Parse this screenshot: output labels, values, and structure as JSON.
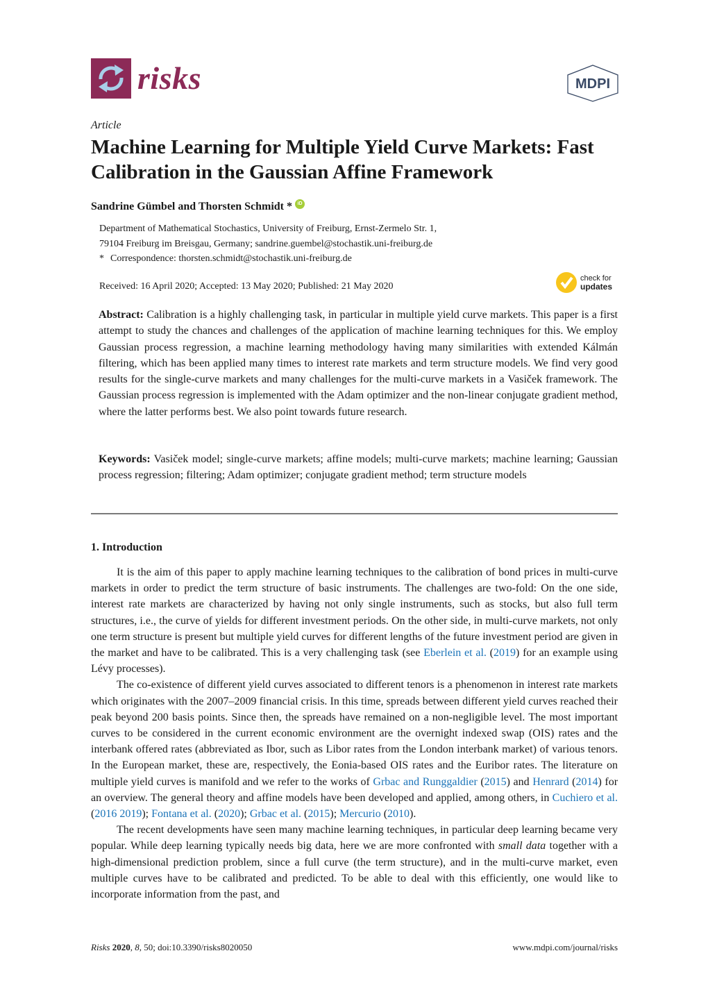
{
  "header": {
    "journal_name": "risks",
    "publisher_logo_text": "MDPI",
    "brand_color": "#8c2a57",
    "icon": "journal-logo-arrows-icon"
  },
  "article": {
    "type": "Article",
    "title": "Machine Learning for Multiple Yield Curve Markets: Fast Calibration in the Gaussian Affine Framework",
    "authors": "Sandrine Gümbel and Thorsten Schmidt *",
    "orcid_label": "iD",
    "affiliation_line1": "Department of Mathematical Stochastics, University of Freiburg, Ernst-Zermelo Str. 1,",
    "affiliation_line2": "79104 Freiburg im Breisgau, Germany; sandrine.guembel@stochastik.uni-freiburg.de",
    "correspondence_marker": "*",
    "correspondence": "Correspondence: thorsten.schmidt@stochastik.uni-freiburg.de",
    "dates": "Received: 16 April 2020; Accepted: 13 May 2020; Published: 21 May 2020",
    "check_updates": {
      "line1": "check for",
      "line2": "updates"
    }
  },
  "abstract": {
    "label": "Abstract:",
    "text": " Calibration is a highly challenging task, in particular in multiple yield curve markets. This paper is a first attempt to study the chances and challenges of the application of machine learning techniques for this. We employ Gaussian process regression, a machine learning methodology having many similarities with extended Kálmán filtering, which has been applied many times to interest rate markets and term structure models. We find very good results for the single-curve markets and many challenges for the multi-curve markets in a Vasiček framework. The Gaussian process regression is implemented with the Adam optimizer and the non-linear conjugate gradient method, where the latter performs best. We also point towards future research."
  },
  "keywords": {
    "label": "Keywords:",
    "text": " Vasiček model; single-curve markets; affine models; multi-curve markets; machine learning; Gaussian process regression; filtering; Adam optimizer; conjugate gradient method; term structure models"
  },
  "section": {
    "heading": "1. Introduction",
    "p1": {
      "a": "It is the aim of this paper to apply machine learning techniques to the calibration of bond prices in multi-curve markets in order to predict the term structure of basic instruments. The challenges are two-fold: On the one side, interest rate markets are characterized by having not only single instruments, such as stocks, but also full term structures, i.e., the curve of yields for different investment periods. On the other side, in multi-curve markets, not only one term structure is present but multiple yield curves for different lengths of the future investment period are given in the market and have to be calibrated. This is a very challenging task (see ",
      "cite1": "Eberlein et al.",
      "b": " (",
      "year1": "2019",
      "c": ") for an example using Lévy processes)."
    },
    "p2": {
      "a": "The co-existence of different yield curves associated to different tenors is a phenomenon in interest rate markets which originates with the 2007–2009 financial crisis. In this time, spreads between different yield curves reached their peak beyond 200 basis points. Since then, the spreads have remained on a non-negligible level. The most important curves to be considered in the current economic environment are the overnight indexed swap (OIS) rates and the interbank offered rates (abbreviated as Ibor, such as Libor rates from the London interbank market) of various tenors. In the European market, these are, respectively, the Eonia-based OIS rates and the Euribor rates. The literature on multiple yield curves is manifold and we refer to the works of ",
      "cite1": "Grbac and Runggaldier",
      "y1": "2015",
      "mid1": " and ",
      "cite2": "Henrard",
      "y2": "2014",
      "mid2": " for an overview. The general theory and affine models have been developed and applied, among others, in ",
      "cite3": "Cuchiero et al.",
      "y3": "2016 2019",
      "cite4": "Fontana et al.",
      "y4": "2020",
      "cite5": "Grbac et al.",
      "y5": "2015",
      "cite6": "Mercurio",
      "y6": "2010"
    },
    "p3": {
      "a": "The recent developments have seen many machine learning techniques, in particular deep learning became very popular. While deep learning typically needs big data, here we are more confronted with ",
      "em": "small data",
      "b": " together with a high-dimensional prediction problem, since a full curve (the term structure), and in the multi-curve market, even multiple curves have to be calibrated and predicted. To be able to deal with this efficiently, one would like to incorporate information from the past, and"
    }
  },
  "footer": {
    "journal": "Risks",
    "year": "2020",
    "volume": "8",
    "rest": ", 50; doi:10.3390/risks8020050",
    "url": "www.mdpi.com/journal/risks"
  }
}
